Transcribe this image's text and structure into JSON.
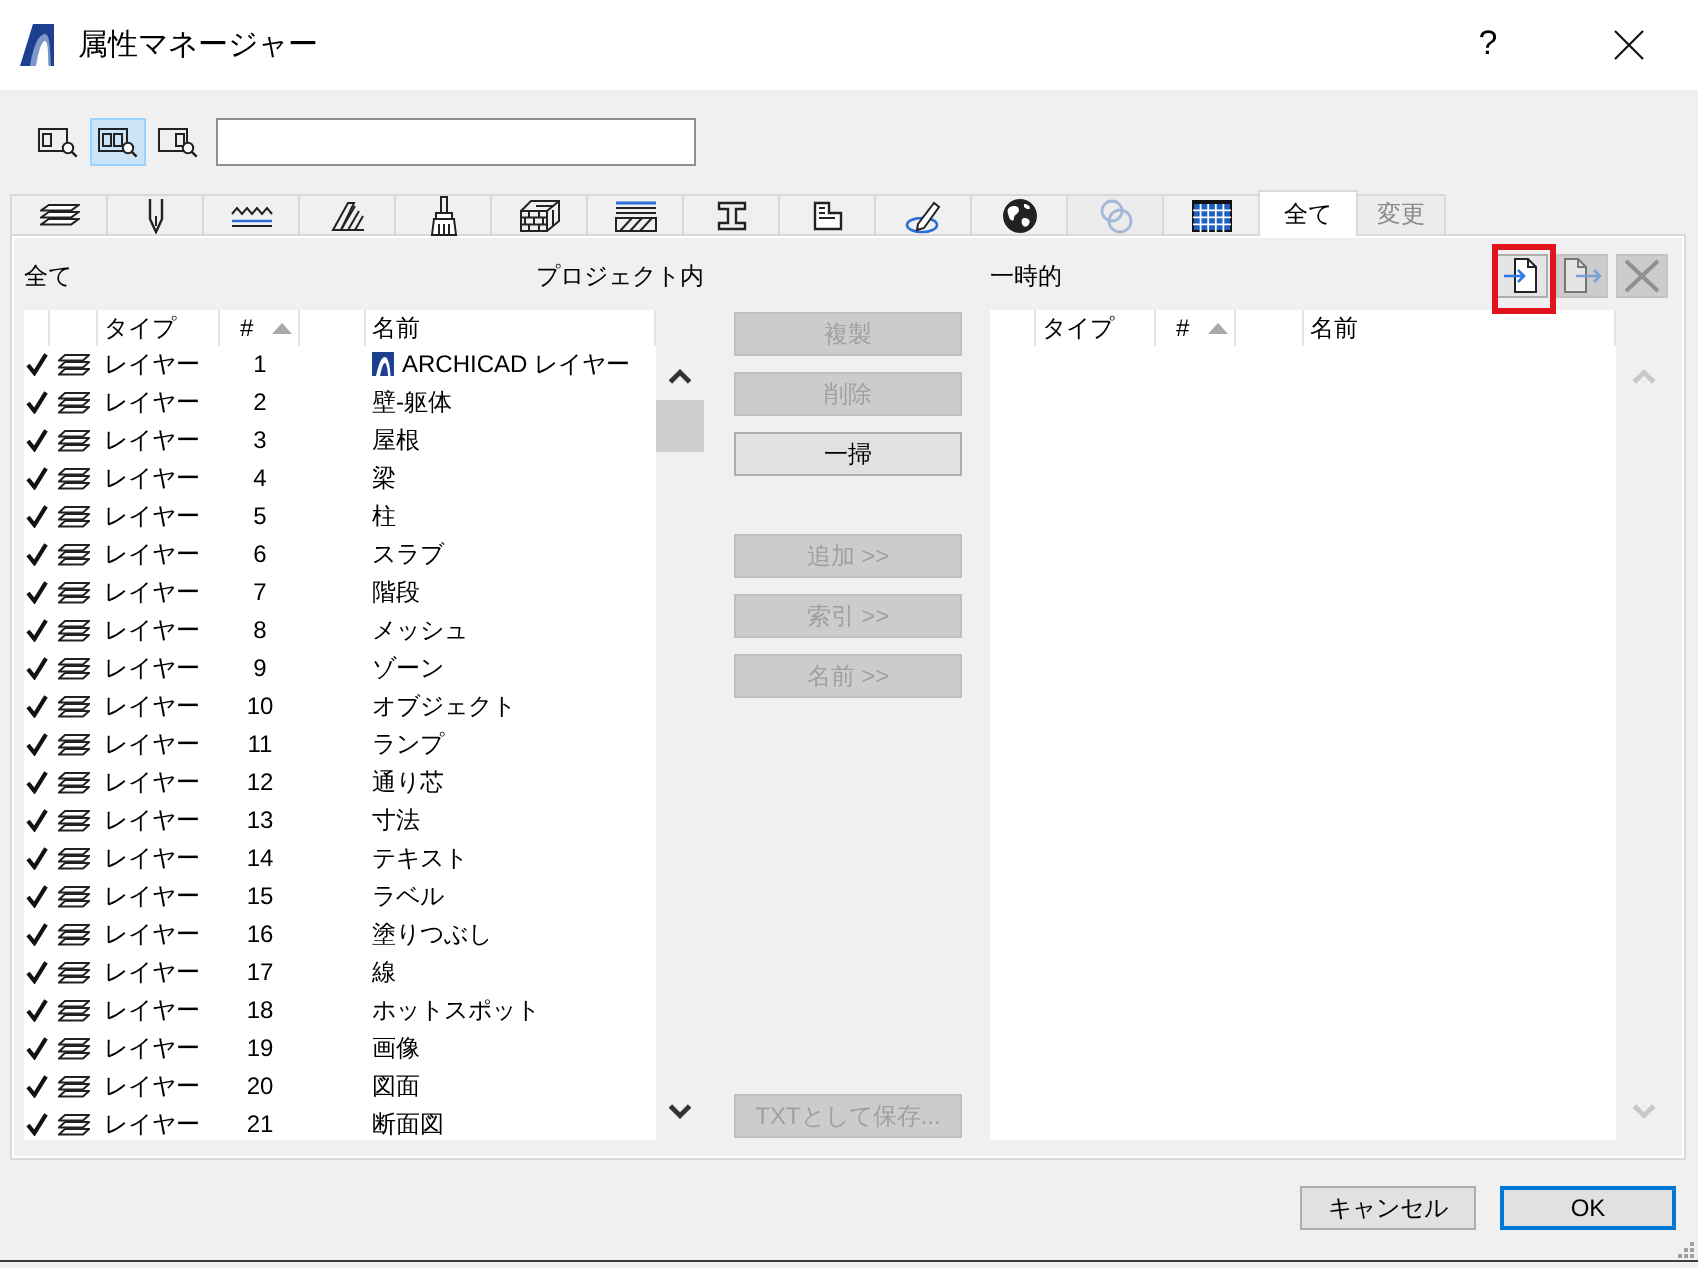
{
  "window": {
    "title": "属性マネージャー",
    "help": "?"
  },
  "toolbar": {
    "view_buttons": [
      {
        "selected": false
      },
      {
        "selected": true
      },
      {
        "selected": false
      }
    ]
  },
  "tabs": [
    {
      "kind": "icon",
      "selected": false,
      "disabled": false
    },
    {
      "kind": "icon",
      "selected": false,
      "disabled": false
    },
    {
      "kind": "icon",
      "selected": false,
      "disabled": false
    },
    {
      "kind": "icon",
      "selected": false,
      "disabled": false
    },
    {
      "kind": "icon",
      "selected": false,
      "disabled": false
    },
    {
      "kind": "icon",
      "selected": false,
      "disabled": false
    },
    {
      "kind": "icon",
      "selected": false,
      "disabled": false
    },
    {
      "kind": "icon",
      "selected": false,
      "disabled": false
    },
    {
      "kind": "icon",
      "selected": false,
      "disabled": false
    },
    {
      "kind": "icon",
      "selected": false,
      "disabled": false
    },
    {
      "kind": "icon",
      "selected": false,
      "disabled": false
    },
    {
      "kind": "icon",
      "selected": false,
      "disabled": true
    },
    {
      "kind": "icon",
      "selected": false,
      "disabled": false
    },
    {
      "kind": "text",
      "label": "全て",
      "selected": true,
      "disabled": false
    },
    {
      "kind": "text",
      "label": "変更",
      "selected": false,
      "disabled": true
    }
  ],
  "left_list": {
    "title": "全て",
    "source": "プロジェクト内",
    "scrollable": true,
    "columns": [
      {
        "label": "タイプ",
        "sorted": false
      },
      {
        "label": "#",
        "sorted": true
      },
      {
        "label": "名前",
        "sorted": false
      }
    ],
    "rows": [
      {
        "checked": true,
        "logo": true,
        "type": "レイヤー",
        "number": "1",
        "name": "ARCHICAD レイヤー"
      },
      {
        "checked": true,
        "logo": false,
        "type": "レイヤー",
        "number": "2",
        "name": "壁-躯体"
      },
      {
        "checked": true,
        "logo": false,
        "type": "レイヤー",
        "number": "3",
        "name": "屋根"
      },
      {
        "checked": true,
        "logo": false,
        "type": "レイヤー",
        "number": "4",
        "name": "梁"
      },
      {
        "checked": true,
        "logo": false,
        "type": "レイヤー",
        "number": "5",
        "name": "柱"
      },
      {
        "checked": true,
        "logo": false,
        "type": "レイヤー",
        "number": "6",
        "name": "スラブ"
      },
      {
        "checked": true,
        "logo": false,
        "type": "レイヤー",
        "number": "7",
        "name": "階段"
      },
      {
        "checked": true,
        "logo": false,
        "type": "レイヤー",
        "number": "8",
        "name": "メッシュ"
      },
      {
        "checked": true,
        "logo": false,
        "type": "レイヤー",
        "number": "9",
        "name": "ゾーン"
      },
      {
        "checked": true,
        "logo": false,
        "type": "レイヤー",
        "number": "10",
        "name": "オブジェクト"
      },
      {
        "checked": true,
        "logo": false,
        "type": "レイヤー",
        "number": "11",
        "name": "ランプ"
      },
      {
        "checked": true,
        "logo": false,
        "type": "レイヤー",
        "number": "12",
        "name": "通り芯"
      },
      {
        "checked": true,
        "logo": false,
        "type": "レイヤー",
        "number": "13",
        "name": "寸法"
      },
      {
        "checked": true,
        "logo": false,
        "type": "レイヤー",
        "number": "14",
        "name": "テキスト"
      },
      {
        "checked": true,
        "logo": false,
        "type": "レイヤー",
        "number": "15",
        "name": "ラベル"
      },
      {
        "checked": true,
        "logo": false,
        "type": "レイヤー",
        "number": "16",
        "name": "塗りつぶし"
      },
      {
        "checked": true,
        "logo": false,
        "type": "レイヤー",
        "number": "17",
        "name": "線"
      },
      {
        "checked": true,
        "logo": false,
        "type": "レイヤー",
        "number": "18",
        "name": "ホットスポット"
      },
      {
        "checked": true,
        "logo": false,
        "type": "レイヤー",
        "number": "19",
        "name": "画像"
      },
      {
        "checked": true,
        "logo": false,
        "type": "レイヤー",
        "number": "20",
        "name": "図面"
      },
      {
        "checked": true,
        "logo": false,
        "type": "レイヤー",
        "number": "21",
        "name": "断面図"
      }
    ]
  },
  "actions": {
    "groups": [
      {
        "buttons": [
          {
            "label": "複製",
            "disabled": true
          },
          {
            "label": "削除",
            "disabled": true
          },
          {
            "label": "一掃",
            "disabled": false
          }
        ]
      },
      {
        "buttons": [
          {
            "label": "追加 >>",
            "disabled": true
          },
          {
            "label": "索引 >>",
            "disabled": true
          },
          {
            "label": "名前 >>",
            "disabled": true
          }
        ]
      }
    ],
    "save": {
      "label": "TXTとして保存...",
      "disabled": true
    }
  },
  "right_list": {
    "title": "一時的",
    "scrollable": false,
    "tools": [
      {
        "kind": "import",
        "disabled": false,
        "highlighted": true
      },
      {
        "kind": "export",
        "disabled": true,
        "highlighted": false
      },
      {
        "kind": "delete",
        "disabled": true,
        "highlighted": false
      }
    ],
    "columns": [
      {
        "label": "タイプ",
        "sorted": false
      },
      {
        "label": "#",
        "sorted": true
      },
      {
        "label": "名前",
        "sorted": false
      }
    ]
  },
  "footer": {
    "buttons": [
      {
        "label": "キャンセル",
        "default": false
      },
      {
        "label": "OK",
        "default": true
      }
    ]
  }
}
